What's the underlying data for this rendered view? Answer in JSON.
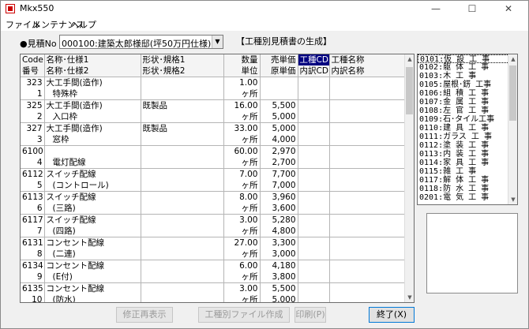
{
  "window": {
    "title": "Mkx550",
    "minimize": "—",
    "maximize": "☐",
    "close": "✕"
  },
  "menu": [
    "ファイル",
    "メンテナンス",
    "ヘルプ"
  ],
  "estimate": {
    "label": "●見積No",
    "selected": "000100:建築太郎様邸(坪50万円仕様)",
    "title": "【工種別見積書の生成】"
  },
  "grid": {
    "headers": [
      [
        "Code",
        "名称･仕様1",
        "形状･規格1",
        "数量",
        "売単価",
        "工種CD",
        "工種名称"
      ],
      [
        "番号",
        "名称･仕様2",
        "形状･規格2",
        "単位",
        "原単価",
        "内訳CD",
        "内訳名称"
      ]
    ],
    "records": [
      {
        "code": "323",
        "no": "1",
        "name1": "大工手間(造作)",
        "name2": "特殊枠",
        "shape1": "",
        "shape2": "",
        "qty": "1.00",
        "unit": "ヶ所",
        "sell": "",
        "cost": ""
      },
      {
        "code": "325",
        "no": "2",
        "name1": "大工手間(造作)",
        "name2": "入口枠",
        "shape1": "既製品",
        "shape2": "",
        "qty": "16.00",
        "unit": "ヶ所",
        "sell": "5,500",
        "cost": "5,000"
      },
      {
        "code": "327",
        "no": "3",
        "name1": "大工手間(造作)",
        "name2": "窓枠",
        "shape1": "既製品",
        "shape2": "",
        "qty": "33.00",
        "unit": "ヶ所",
        "sell": "5,000",
        "cost": "4,000"
      },
      {
        "code": "6100",
        "no": "4",
        "name1": "",
        "name2": "電灯配線",
        "shape1": "",
        "shape2": "",
        "qty": "60.00",
        "unit": "ヶ所",
        "sell": "2,970",
        "cost": "2,700"
      },
      {
        "code": "6112",
        "no": "5",
        "name1": "スイッチ配線",
        "name2": "(コントロール)",
        "shape1": "",
        "shape2": "",
        "qty": "7.00",
        "unit": "ヶ所",
        "sell": "7,700",
        "cost": "7,000"
      },
      {
        "code": "6113",
        "no": "6",
        "name1": "スイッチ配線",
        "name2": "(三路)",
        "shape1": "",
        "shape2": "",
        "qty": "8.00",
        "unit": "ヶ所",
        "sell": "3,960",
        "cost": "3,600"
      },
      {
        "code": "6117",
        "no": "7",
        "name1": "スイッチ配線",
        "name2": "(四路)",
        "shape1": "",
        "shape2": "",
        "qty": "3.00",
        "unit": "ヶ所",
        "sell": "5,280",
        "cost": "4,800"
      },
      {
        "code": "6131",
        "no": "8",
        "name1": "コンセント配線",
        "name2": "(二連)",
        "shape1": "",
        "shape2": "",
        "qty": "27.00",
        "unit": "ヶ所",
        "sell": "3,300",
        "cost": "3,000"
      },
      {
        "code": "6134",
        "no": "9",
        "name1": "コンセント配線",
        "name2": "(E付)",
        "shape1": "",
        "shape2": "",
        "qty": "6.00",
        "unit": "ヶ所",
        "sell": "4,180",
        "cost": "3,800"
      },
      {
        "code": "6135",
        "no": "10",
        "name1": "コンセント配線",
        "name2": "(防水)",
        "shape1": "",
        "shape2": "",
        "qty": "3.00",
        "unit": "ヶ所",
        "sell": "5,500",
        "cost": "5,000"
      }
    ]
  },
  "worktypes": [
    "0101:仮 設 工 事",
    "0102:躯 体 工 事",
    "0103:木  工  事",
    "0105:屋根･錺 工事",
    "0106:組 積 工 事",
    "0107:金 属 工 事",
    "0108:左 官 工 事",
    "0109:石･タイル工事",
    "0110:建 具 工 事",
    "0111:ガラス 工 事",
    "0112:塗 装 工 事",
    "0113:内 装 工 事",
    "0114:家 具 工 事",
    "0115:雑   工  事",
    "0117:解 体 工 事",
    "0118:防 水 工 事",
    "0201:電 気 工 事"
  ],
  "buttons": {
    "refresh": "修正再表示",
    "create": "工種別ファイル作成",
    "print": "印刷(P)",
    "exit": "終了(X)"
  }
}
